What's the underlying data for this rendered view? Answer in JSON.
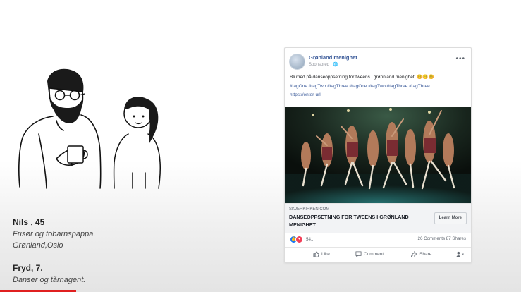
{
  "persona": {
    "nils_name": "Nils , 45",
    "nils_line1": "Frisør og tobarnspappa.",
    "nils_line2": "Grønland,Oslo",
    "fryd_name": "Fryd, 7.",
    "fryd_line1": "Danser og tårnagent."
  },
  "post": {
    "page_name": "Grønland menighet",
    "sponsored": "Sponsored · ",
    "text": "Bli med på danseoppsetning for tweens i grønnland menighet! 😊😊😊",
    "tags": "#tagOne #tagTwo #tagThree #tagOne #tagTwo #tagThree #tagThree",
    "url": "https://enter-url",
    "link_domain": "SKJERKIRKEN.COM",
    "link_headline": "DANSEOPPSETNING FOR TWEENS I GRØNLAND MENIGHET",
    "cta": "Learn More",
    "reaction_count": "541",
    "comments_shares": "26 Comments  87 Shares",
    "like_label": "Like",
    "comment_label": "Comment",
    "share_label": "Share"
  },
  "colors": {
    "link_blue": "#385898",
    "like_blue": "#1877f2",
    "love_red": "#f33e58",
    "progress_red": "#e02020"
  }
}
